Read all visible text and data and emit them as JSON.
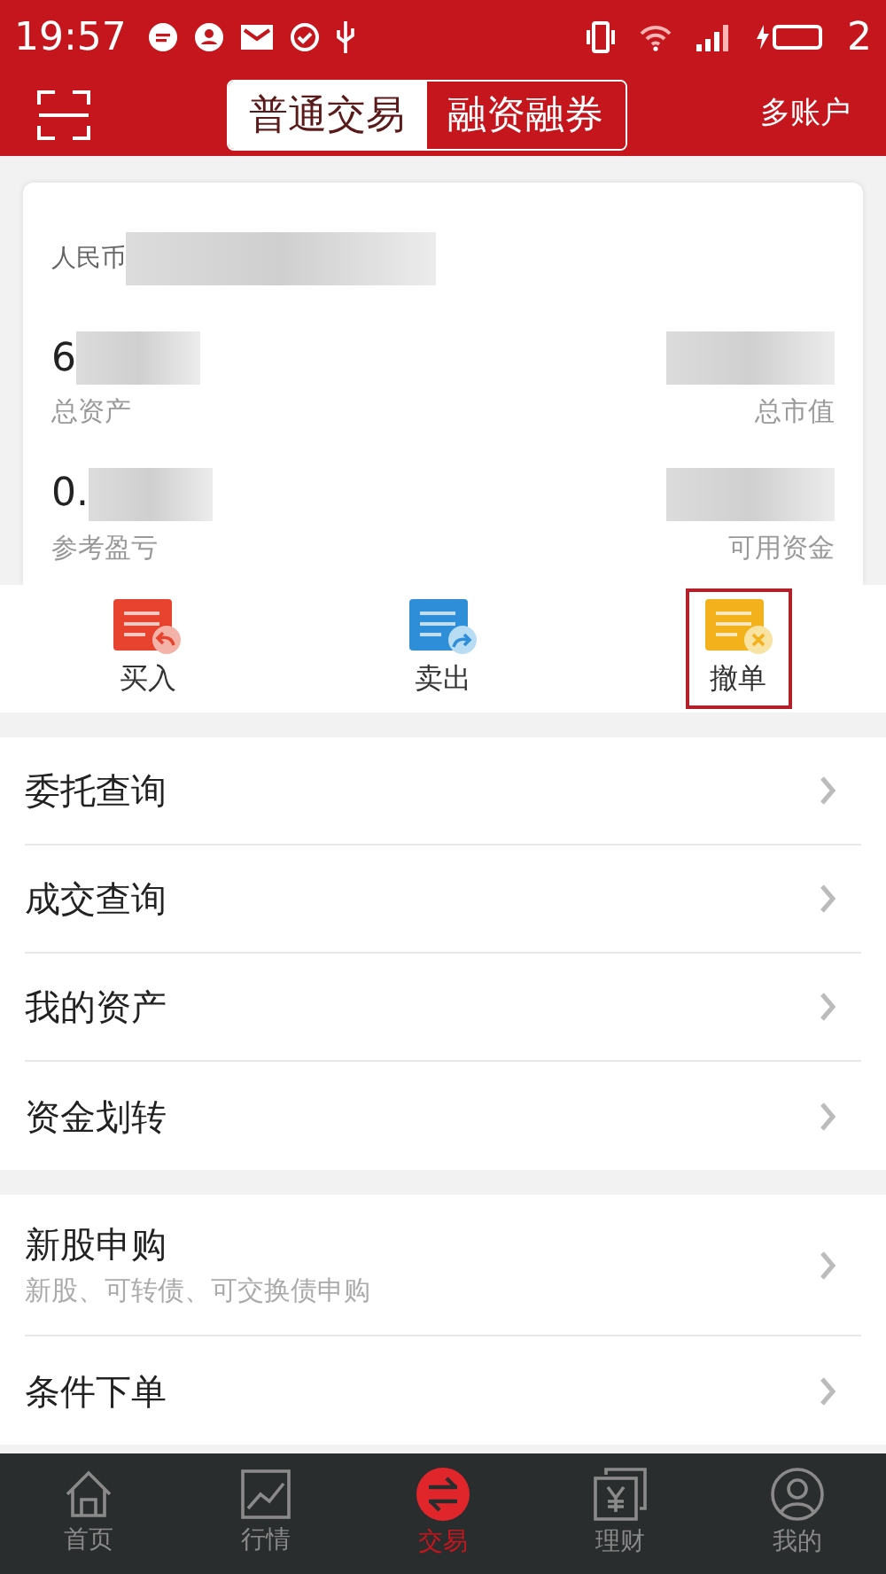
{
  "status_bar": {
    "time": "19:57",
    "battery": "2"
  },
  "header": {
    "tabs": [
      {
        "label": "普通交易",
        "selected": true
      },
      {
        "label": "融资融券",
        "selected": false
      }
    ],
    "right_link": "多账户"
  },
  "summary": {
    "currency": "人民币",
    "stats": [
      {
        "value": "6",
        "label": "总资产"
      },
      {
        "label": "总市值"
      },
      {
        "value": "0.",
        "label": "参考盈亏"
      },
      {
        "label": "可用资金"
      }
    ]
  },
  "actions": [
    {
      "label": "买入",
      "kind": "buy",
      "selected": false
    },
    {
      "label": "卖出",
      "kind": "sell",
      "selected": false
    },
    {
      "label": "撤单",
      "kind": "cancel",
      "selected": true
    }
  ],
  "menu_groups": [
    [
      {
        "title": "委托查询"
      },
      {
        "title": "成交查询"
      },
      {
        "title": "我的资产"
      },
      {
        "title": "资金划转"
      }
    ],
    [
      {
        "title": "新股申购",
        "subtitle": "新股、可转债、可交换债申购"
      },
      {
        "title": "条件下单"
      }
    ]
  ],
  "bottom_nav": [
    {
      "label": "首页",
      "kind": "home",
      "selected": false
    },
    {
      "label": "行情",
      "kind": "chart",
      "selected": false
    },
    {
      "label": "交易",
      "kind": "trade",
      "selected": true
    },
    {
      "label": "理财",
      "kind": "finance",
      "selected": false
    },
    {
      "label": "我的",
      "kind": "profile",
      "selected": false
    }
  ]
}
